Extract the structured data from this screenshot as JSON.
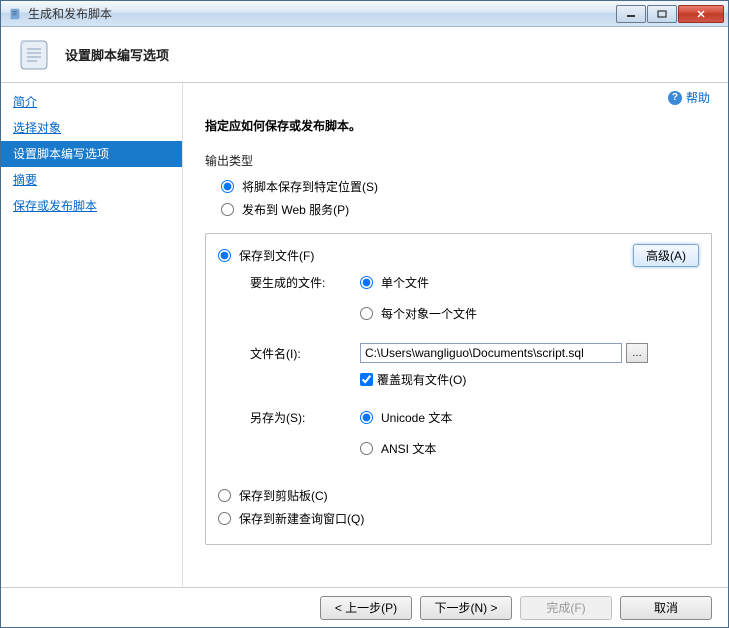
{
  "window": {
    "title": "生成和发布脚本"
  },
  "header": {
    "title": "设置脚本编写选项"
  },
  "sidebar": {
    "items": [
      {
        "label": "简介"
      },
      {
        "label": "选择对象"
      },
      {
        "label": "设置脚本编写选项"
      },
      {
        "label": "摘要"
      },
      {
        "label": "保存或发布脚本"
      }
    ],
    "activeIndex": 2
  },
  "help": {
    "label": "帮助"
  },
  "content": {
    "instruction": "指定应如何保存或发布脚本。",
    "outputTypeLabel": "输出类型",
    "outputType": {
      "saveToLocation": "将脚本保存到特定位置(S)",
      "publishToWeb": "发布到 Web 服务(P)"
    },
    "saveToFile": {
      "label": "保存到文件(F)",
      "advanced": "高级(A)",
      "filesToGenerateLabel": "要生成的文件:",
      "singleFile": "单个文件",
      "perObject": "每个对象一个文件",
      "fileNameLabel": "文件名(I):",
      "fileNameValue": "C:\\Users\\wangliguo\\Documents\\script.sql",
      "overwrite": "覆盖现有文件(O)",
      "saveAsLabel": "另存为(S):",
      "unicode": "Unicode 文本",
      "ansi": "ANSI 文本"
    },
    "saveToClipboard": "保存到剪贴板(C)",
    "saveToQueryWindow": "保存到新建查询窗口(Q)"
  },
  "footer": {
    "prev": "< 上一步(P)",
    "next": "下一步(N) >",
    "finish": "完成(F)",
    "cancel": "取消"
  }
}
